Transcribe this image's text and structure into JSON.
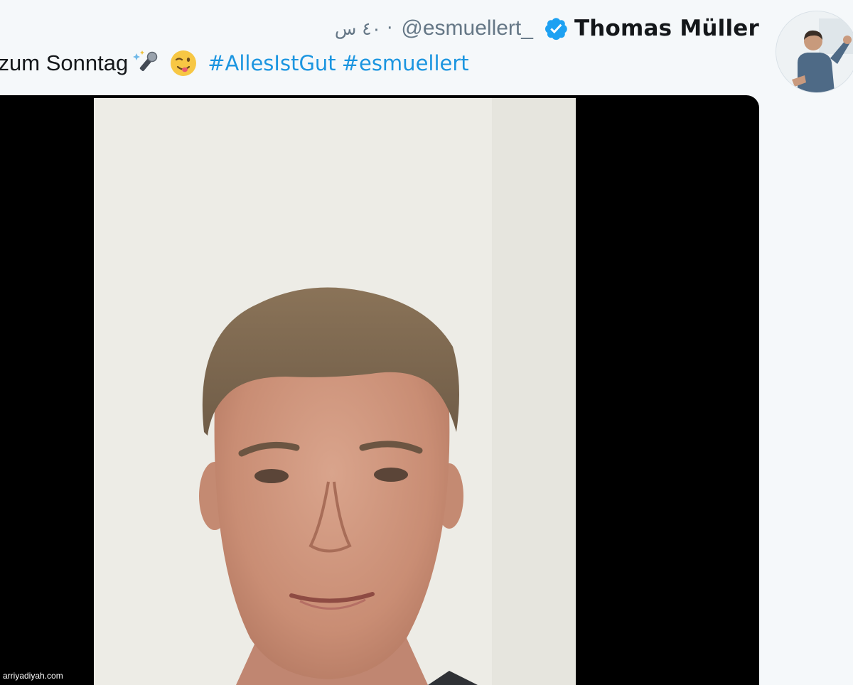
{
  "tweet": {
    "author": {
      "display_name": "Thomas Müller",
      "handle": "@esmuellert_",
      "verified_icon": "verified-badge-icon",
      "avatar_icon": "profile-photo"
    },
    "time_ago": "٤٠ س",
    "separator": "·",
    "text": {
      "body": "rt zum Sonntag",
      "emojis": [
        "microphone-sparkles-emoji",
        "winking-tongue-face-emoji"
      ],
      "hashtags": [
        "#AllesIstGut",
        "#esmuellert"
      ]
    }
  },
  "media": {
    "type": "video",
    "content": "selfie-video"
  },
  "watermark": "arriyadiyah.com",
  "colors": {
    "link": "#1b95e0",
    "verified": "#1da1f2",
    "text": "#14171a",
    "secondary_text": "#657786",
    "background": "#f5f8fa",
    "media_background": "#000000"
  }
}
